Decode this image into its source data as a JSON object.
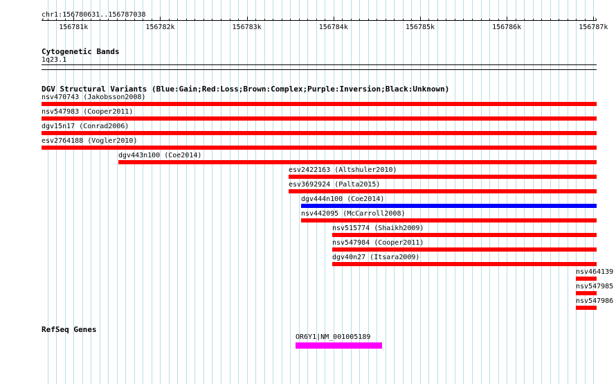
{
  "locus": "chr1:156780631..156787038",
  "ruler": {
    "start": 156780631,
    "end": 156787038,
    "ticks": [
      {
        "pos": 156781000,
        "label": "156781k"
      },
      {
        "pos": 156782000,
        "label": "156782k"
      },
      {
        "pos": 156783000,
        "label": "156783k"
      },
      {
        "pos": 156784000,
        "label": "156784k"
      },
      {
        "pos": 156785000,
        "label": "156785k"
      },
      {
        "pos": 156786000,
        "label": "156786k"
      },
      {
        "pos": 156787000,
        "label": "156787k"
      }
    ]
  },
  "cytobands": {
    "title": "Cytogenetic Bands",
    "band": "1q23.1"
  },
  "dgv": {
    "title": "DGV Structural Variants (Blue:Gain;Red:Loss;Brown:Complex;Purple:Inversion;Black:Unknown)",
    "variants": [
      {
        "label": "nsv470743 (Jakobsson2008)",
        "start": 156780631,
        "end": 156787038,
        "color": "#ff0000"
      },
      {
        "label": "nsv547983 (Cooper2011)",
        "start": 156780631,
        "end": 156787038,
        "color": "#ff0000"
      },
      {
        "label": "dgv15n17 (Conrad2006)",
        "start": 156780631,
        "end": 156787038,
        "color": "#ff0000"
      },
      {
        "label": "esv2764188 (Vogler2010)",
        "start": 156780631,
        "end": 156787038,
        "color": "#ff0000"
      },
      {
        "label": "dgv443n100 (Coe2014)",
        "start": 156781520,
        "end": 156787038,
        "color": "#ff0000"
      },
      {
        "label": "esv2422163 (Altshuler2010)",
        "start": 156783480,
        "end": 156787038,
        "color": "#ff0000"
      },
      {
        "label": "esv3692924 (Palta2015)",
        "start": 156783480,
        "end": 156787038,
        "color": "#ff0000"
      },
      {
        "label": "dgv444n100 (Coe2014)",
        "start": 156783630,
        "end": 156787038,
        "color": "#0000ff"
      },
      {
        "label": "nsv442095 (McCarroll2008)",
        "start": 156783630,
        "end": 156787038,
        "color": "#ff0000"
      },
      {
        "label": "nsv515774 (Shaikh2009)",
        "start": 156783990,
        "end": 156787038,
        "color": "#ff0000"
      },
      {
        "label": "nsv547984 (Cooper2011)",
        "start": 156783990,
        "end": 156787038,
        "color": "#ff0000"
      },
      {
        "label": "dgv40n27 (Itsara2009)",
        "start": 156783990,
        "end": 156787038,
        "color": "#ff0000"
      },
      {
        "label": "nsv464139",
        "start": 156786800,
        "end": 156787038,
        "color": "#ff0000"
      },
      {
        "label": "nsv547985",
        "start": 156786800,
        "end": 156787038,
        "color": "#ff0000"
      },
      {
        "label": "nsv547986",
        "start": 156786800,
        "end": 156787038,
        "color": "#ff0000"
      }
    ]
  },
  "refseq": {
    "title": "RefSeq Genes",
    "genes": [
      {
        "label": "OR6Y1|NM_001005189",
        "start": 156783560,
        "end": 156784560,
        "color": "#ff00ff"
      }
    ]
  },
  "colors": {
    "gridline": "#b8dceb",
    "loss": "#ff0000",
    "gain": "#0000ff",
    "gene": "#ff00ff"
  }
}
